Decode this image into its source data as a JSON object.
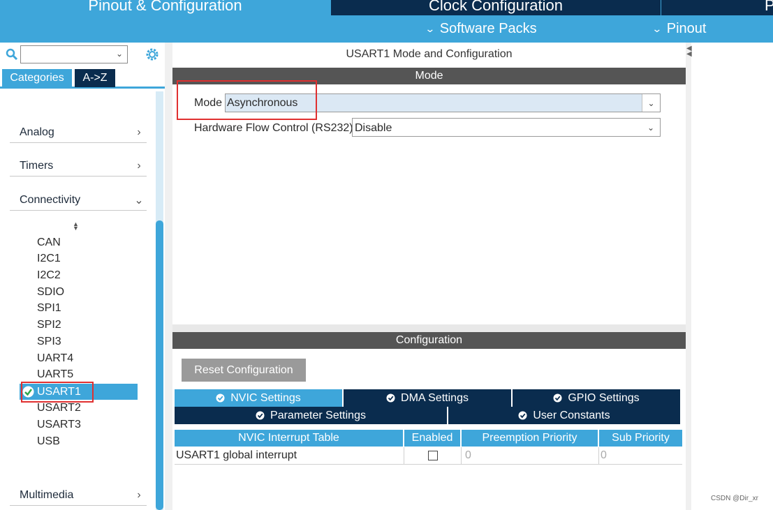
{
  "top_tabs": {
    "pinout": "Pinout & Configuration",
    "clock": "Clock Configuration",
    "extra": "P"
  },
  "sub_bar": {
    "software_packs": "Software Packs",
    "pinout": "Pinout"
  },
  "left_panel": {
    "search": {
      "value": ""
    },
    "tabs": {
      "categories": "Categories",
      "az": "A->Z"
    },
    "sections": {
      "analog": "Analog",
      "timers": "Timers",
      "connectivity": "Connectivity",
      "multimedia": "Multimedia"
    },
    "connectivity_items": [
      "CAN",
      "I2C1",
      "I2C2",
      "SDIO",
      "SPI1",
      "SPI2",
      "SPI3",
      "UART4",
      "UART5",
      "USART1",
      "USART2",
      "USART3",
      "USB"
    ],
    "selected_item": "USART1"
  },
  "main": {
    "title": "USART1 Mode and Configuration",
    "mode_bar": "Mode",
    "mode_label": "Mode",
    "mode_value": "Asynchronous",
    "hfc_label": "Hardware Flow Control (RS232)",
    "hfc_value": "Disable",
    "config_bar": "Configuration",
    "reset_button": "Reset Configuration",
    "settings_tabs": {
      "nvic": "NVIC Settings",
      "dma": "DMA Settings",
      "gpio": "GPIO Settings",
      "parameter": "Parameter Settings",
      "user_constants": "User Constants"
    },
    "table": {
      "headers": [
        "NVIC Interrupt Table",
        "Enabled",
        "Preemption Priority",
        "Sub Priority"
      ],
      "rows": [
        {
          "name": "USART1 global interrupt",
          "enabled": false,
          "preemption": "0",
          "sub": "0"
        }
      ]
    }
  },
  "watermark": "CSDN @Dir_xr",
  "colors": {
    "accent": "#3ea6da",
    "dark_tab": "#0a2c4e",
    "bar_gray": "#555555",
    "highlight_red": "#e03030"
  }
}
